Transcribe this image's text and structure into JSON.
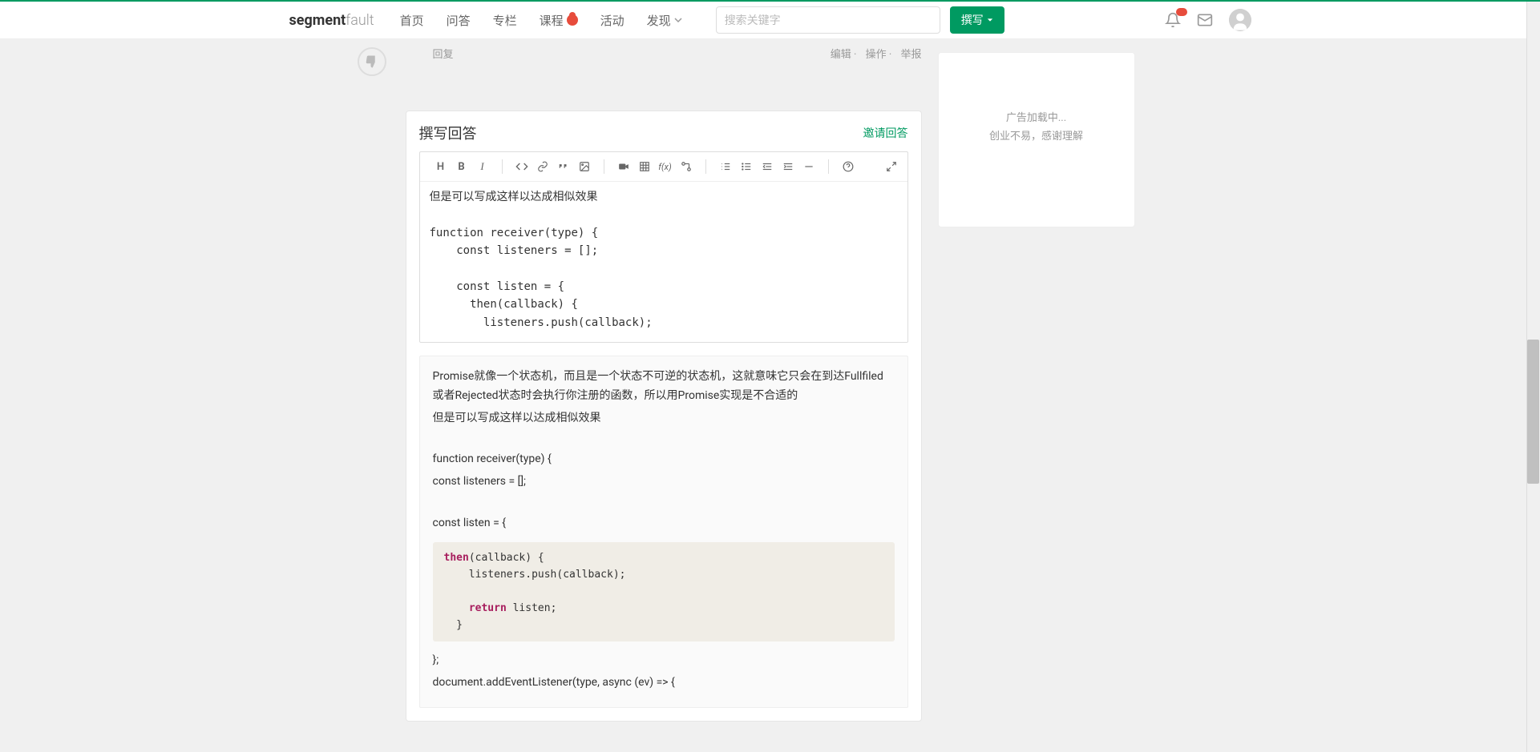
{
  "header": {
    "logo_bold": "segment",
    "logo_thin": "fault",
    "nav": [
      "首页",
      "问答",
      "专栏",
      "课程",
      "活动",
      "发现"
    ],
    "search_placeholder": "搜索关键字",
    "write_btn": "撰写"
  },
  "answer_meta": {
    "reply": "回复",
    "edit": "编辑",
    "operate": "操作",
    "report": "举报"
  },
  "editor": {
    "title": "撰写回答",
    "invite": "邀请回答",
    "textarea_content": "但是可以写成这样以达成相似效果\n\nfunction receiver(type) {\n    const listeners = [];\n\n    const listen = {\n      then(callback) {\n        listeners.push(callback);\n\n        return listen;\n      }"
  },
  "preview": {
    "p1": "Promise就像一个状态机，而且是一个状态不可逆的状态机，这就意味它只会在到达Fullfiled或者Rejected状态时会执行你注册的函数，所以用Promise实现是不合适的",
    "p2": "但是可以写成这样以达成相似效果",
    "p3": "function receiver(type) {",
    "p4": "const listeners = [];",
    "p5": "const listen = {",
    "code_kw_then": "then",
    "code_line1": "(callback) {",
    "code_line2": "    listeners.push(callback);",
    "code_kw_return": "return",
    "code_line3": " listen;",
    "code_line4": "  }",
    "p6": "};",
    "p7": "document.addEventListener(type, async (ev) => {"
  },
  "sidebar": {
    "ad_loading": "广告加载中...",
    "ad_note": "创业不易，感谢理解"
  },
  "toolbar_icons": {
    "h": "H",
    "b": "B",
    "i": "I",
    "fx": "f(x)",
    "help": "?"
  }
}
